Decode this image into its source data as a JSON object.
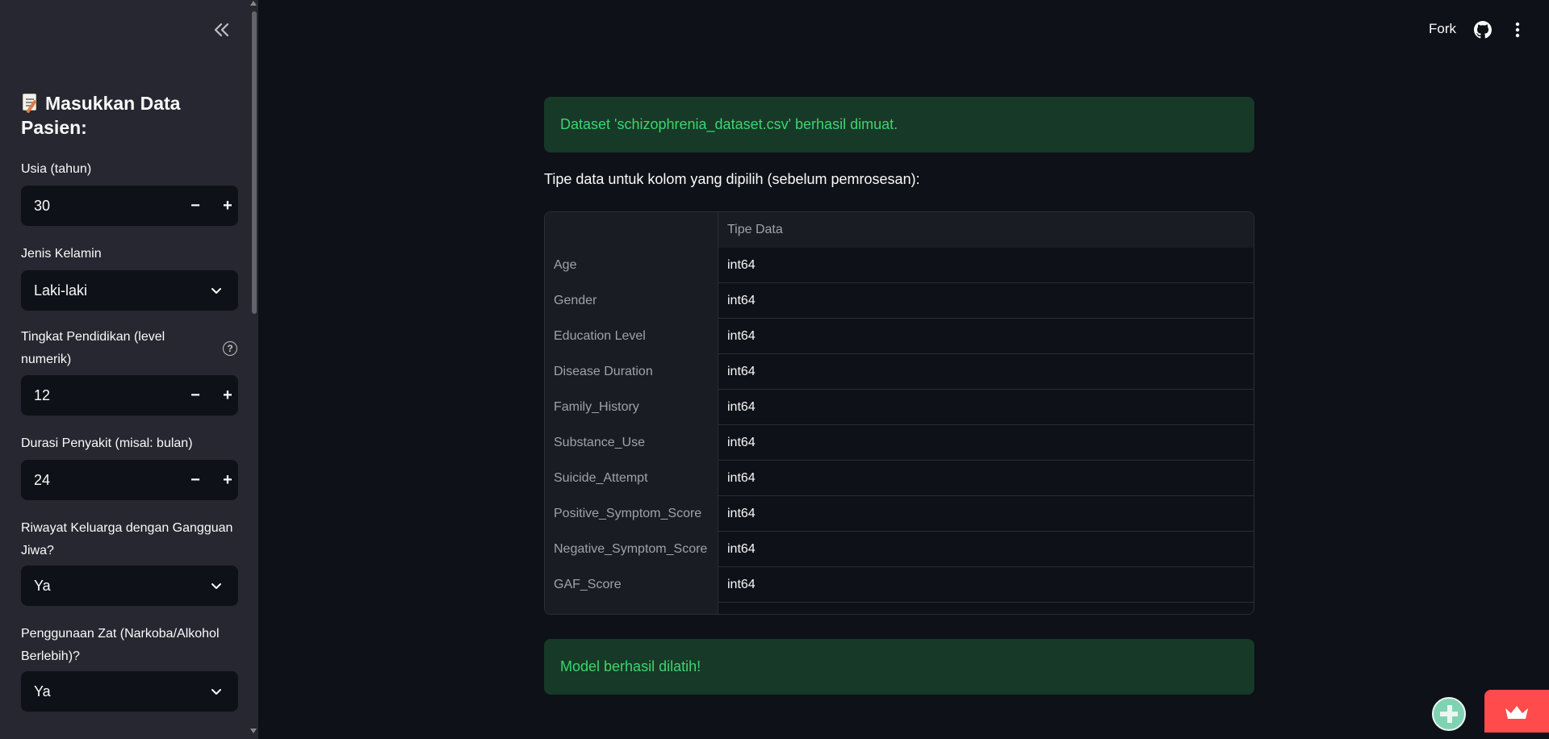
{
  "sidebar": {
    "heading": "Masukkan Data Pasien:",
    "fields": [
      {
        "label": "Usia (tahun)",
        "value": "30",
        "type": "number"
      },
      {
        "label": "Jenis Kelamin",
        "value": "Laki-laki",
        "type": "select"
      },
      {
        "label": "Tingkat Pendidikan (level numerik)",
        "value": "12",
        "type": "number",
        "help": "?"
      },
      {
        "label": "Durasi Penyakit (misal: bulan)",
        "value": "24",
        "type": "number"
      },
      {
        "label": "Riwayat Keluarga dengan Gangguan Jiwa?",
        "value": "Ya",
        "type": "select"
      },
      {
        "label": "Penggunaan Zat (Narkoba/Alkohol Berlebih)?",
        "value": "Ya",
        "type": "select"
      }
    ],
    "minus_glyph": "−",
    "plus_glyph": "+"
  },
  "topbar": {
    "fork_label": "Fork"
  },
  "main": {
    "alert_dataset": "Dataset 'schizophrenia_dataset.csv' berhasil dimuat.",
    "info_text": "Tipe data untuk kolom yang dipilih (sebelum pemrosesan):",
    "table": {
      "header": [
        "",
        "Tipe Data"
      ],
      "rows": [
        [
          "Age",
          "int64"
        ],
        [
          "Gender",
          "int64"
        ],
        [
          "Education Level",
          "int64"
        ],
        [
          "Disease Duration",
          "int64"
        ],
        [
          "Family_History",
          "int64"
        ],
        [
          "Substance_Use",
          "int64"
        ],
        [
          "Suicide_Attempt",
          "int64"
        ],
        [
          "Positive_Symptom_Score",
          "int64"
        ],
        [
          "Negative_Symptom_Score",
          "int64"
        ],
        [
          "GAF_Score",
          "int64"
        ]
      ]
    },
    "alert_model": "Model berhasil dilatih!"
  },
  "colors": {
    "sidebar_bg": "#262730",
    "main_bg": "#0e1117",
    "success_bg": "#173928",
    "success_text": "#3dd56d",
    "accent_red": "#ff4b4b"
  },
  "icons": [
    "collapse-sidebar-icon",
    "memo-icon",
    "help-icon",
    "chevron-down-icon",
    "github-icon",
    "kebab-menu-icon",
    "crown-icon"
  ]
}
